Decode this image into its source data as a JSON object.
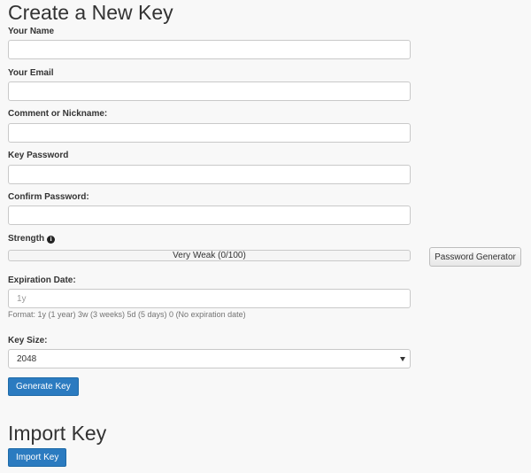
{
  "create": {
    "heading": "Create a New Key",
    "name_label": "Your Name",
    "name_value": "",
    "email_label": "Your Email",
    "email_value": "",
    "comment_label": "Comment or Nickname:",
    "comment_value": "",
    "password_label": "Key Password",
    "password_value": "",
    "confirm_label": "Confirm Password:",
    "confirm_value": "",
    "strength_label": "Strength",
    "strength_text": "Very Weak (0/100)",
    "strength_score": 0,
    "password_generator_label": "Password Generator",
    "expiration_label": "Expiration Date:",
    "expiration_placeholder": "1y",
    "expiration_help": "Format: 1y (1 year) 3w (3 weeks) 5d (5 days) 0 (No expiration date)",
    "keysize_label": "Key Size:",
    "keysize_value": "2048",
    "generate_button": "Generate Key"
  },
  "import": {
    "heading": "Import Key",
    "button": "Import Key"
  }
}
